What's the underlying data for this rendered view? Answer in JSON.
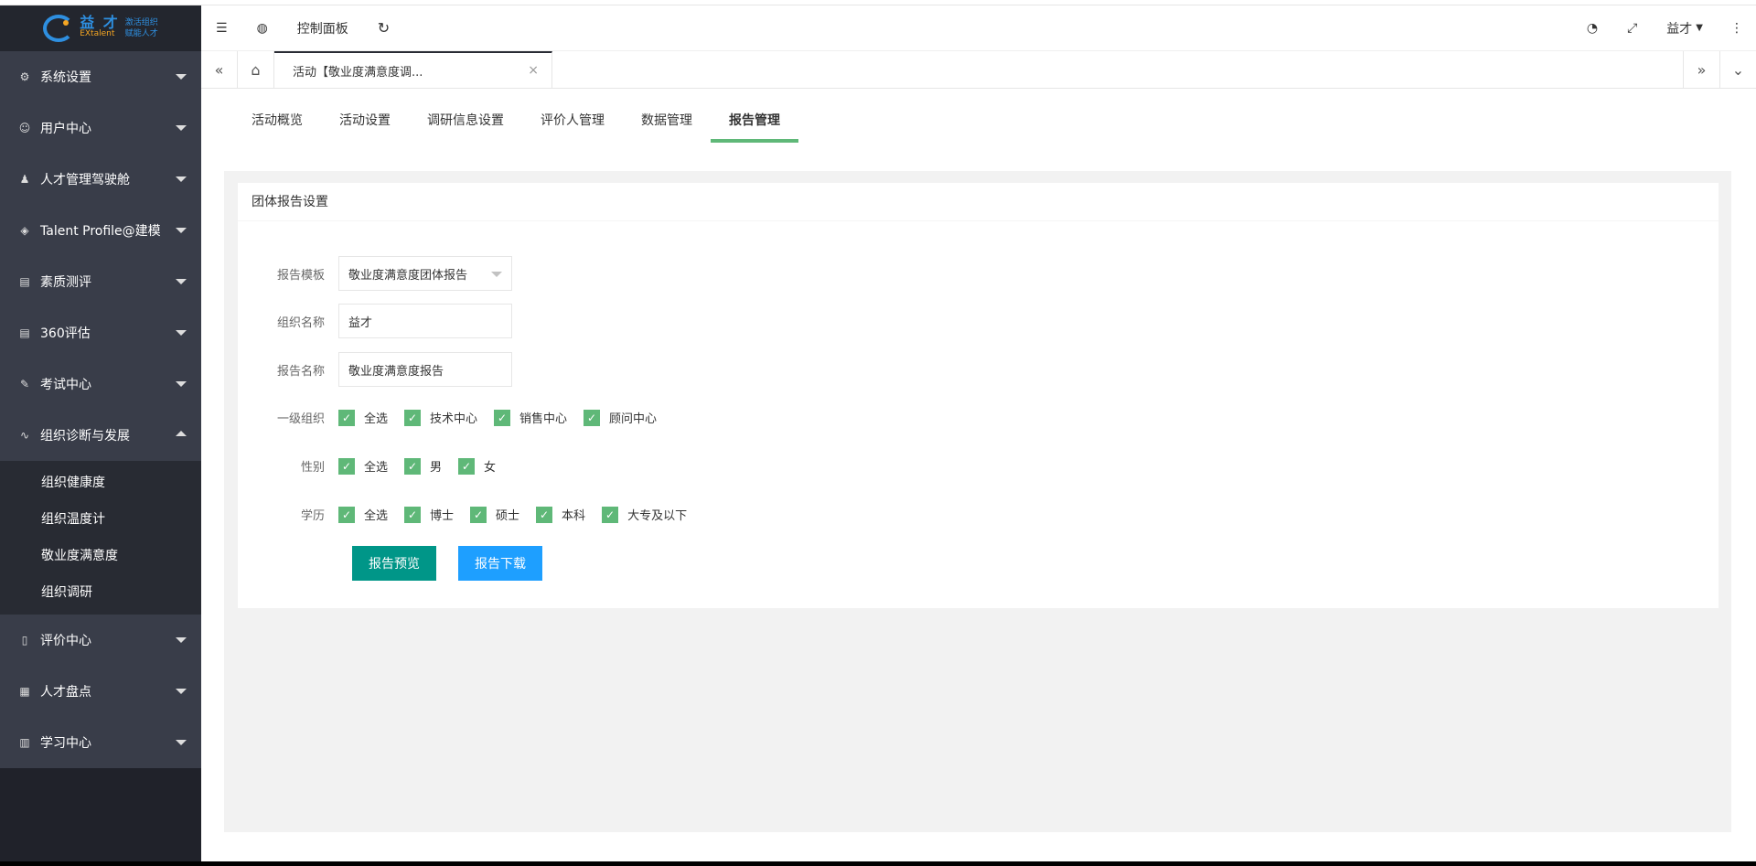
{
  "logo": {
    "name_cn": "益 才",
    "name_en": "EXtalent",
    "slogan_1": "激活组织",
    "slogan_2": "赋能人才"
  },
  "sidebar": {
    "items": [
      {
        "label": "系统设置",
        "icon": "gear-icon"
      },
      {
        "label": "用户中心",
        "icon": "user-icon"
      },
      {
        "label": "人才管理驾驶舱",
        "icon": "users-icon"
      },
      {
        "label": "Talent Profile@建模",
        "icon": "layers-icon"
      },
      {
        "label": "素质测评",
        "icon": "clipboard-icon"
      },
      {
        "label": "360评估",
        "icon": "clipboard-icon"
      },
      {
        "label": "考试中心",
        "icon": "pencil-icon"
      },
      {
        "label": "组织诊断与发展",
        "icon": "pulse-icon"
      },
      {
        "label": "评价中心",
        "icon": "tablet-icon"
      },
      {
        "label": "人才盘点",
        "icon": "grid-icon"
      },
      {
        "label": "学习中心",
        "icon": "book-icon"
      }
    ],
    "submenu": [
      "组织健康度",
      "组织温度计",
      "敬业度满意度",
      "组织调研"
    ]
  },
  "header": {
    "dashboard_label": "控制面板",
    "user_label": "益才"
  },
  "tabs": {
    "current_tab": "活动【敬业度满意度调..."
  },
  "subtabs": [
    "活动概览",
    "活动设置",
    "调研信息设置",
    "评价人管理",
    "数据管理",
    "报告管理"
  ],
  "card": {
    "title": "团体报告设置",
    "template_label": "报告模板",
    "template_value": "敬业度满意度团体报告",
    "org_label": "组织名称",
    "org_value": "益才",
    "report_label": "报告名称",
    "report_value": "敬业度满意度报告",
    "level1_label": "一级组织",
    "level1_options": [
      "全选",
      "技术中心",
      "销售中心",
      "顾问中心"
    ],
    "gender_label": "性别",
    "gender_options": [
      "全选",
      "男",
      "女"
    ],
    "edu_label": "学历",
    "edu_options": [
      "全选",
      "博士",
      "硕士",
      "本科",
      "大专及以下"
    ],
    "preview_button": "报告预览",
    "download_button": "报告下载"
  },
  "colors": {
    "sidebar_bg": "#393d49",
    "accent_green": "#5fb878",
    "btn_teal": "#009688",
    "btn_blue": "#1e9fff"
  }
}
